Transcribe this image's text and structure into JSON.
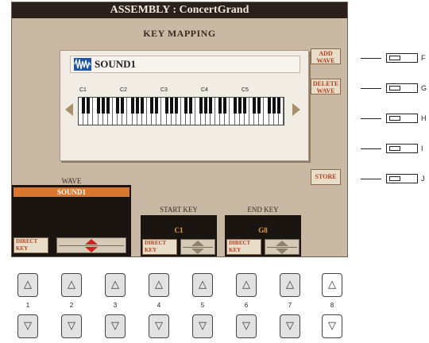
{
  "screen": {
    "title": "ASSEMBLY : ConcertGrand",
    "subtitle": "KEY MAPPING",
    "wave_name": "SOUND1",
    "octave_labels": [
      "C1",
      "C2",
      "C3",
      "C4",
      "C5"
    ],
    "side_buttons": {
      "add_wave": "ADD WAVE",
      "delete_wave": "DELETE WAVE",
      "store": "STORE"
    },
    "wave_section": {
      "label": "WAVE",
      "selected": "SOUND1",
      "direct_key": "DIRECT KEY"
    },
    "start_key": {
      "label": "START KEY",
      "value": "C1",
      "direct_key": "DIRECT KEY"
    },
    "end_key": {
      "label": "END KEY",
      "value": "G8",
      "direct_key": "DIRECT KEY"
    }
  },
  "right_buttons": [
    "F",
    "G",
    "H",
    "I",
    "J"
  ],
  "panel_buttons": {
    "numbers": [
      "1",
      "2",
      "3",
      "4",
      "5",
      "6",
      "7",
      "8"
    ],
    "up_glyph": "△",
    "down_glyph": "▽"
  },
  "colors": {
    "title_bar": "#2a201c",
    "screen_bg": "#c8b8a4",
    "selection": "#d87830",
    "value_text": "#e8a040",
    "button_text": "#b04020"
  },
  "icons": {
    "wave": "waveform-icon",
    "scroll_left": "arrow-left-icon",
    "scroll_right": "arrow-right-icon"
  }
}
